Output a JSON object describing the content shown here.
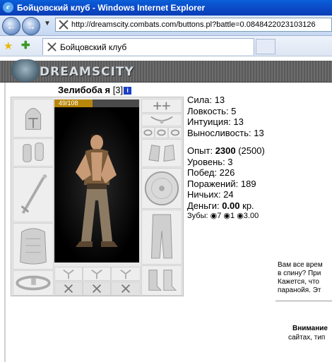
{
  "window": {
    "title": "Бойцовский клуб - Windows Internet Explorer"
  },
  "address_bar": {
    "url": "http://dreamscity.combats.com/buttons.pl?battle=0.0848422023103126"
  },
  "tab": {
    "label": "Бойцовский клуб"
  },
  "banner": {
    "logo_text": "DREAMSCITY"
  },
  "character": {
    "name": "Зелибоба я",
    "level_text": "[3]",
    "hp_text": "49/108",
    "hp_fraction": 0.4537
  },
  "stats": {
    "strength": "Сила: 13",
    "agility": "Ловкость: 5",
    "intuition": "Интуиция: 13",
    "endurance": "Выносливость: 13",
    "exp_label": "Опыт: ",
    "exp_value": "2300",
    "exp_next": " (2500)",
    "level": "Уровень: 3",
    "wins": "Побед: 226",
    "losses": "Поражений: 189",
    "draws": "Ничьих: 24",
    "money_label": "Деньги: ",
    "money_value": "0.00",
    "money_unit": " кр.",
    "teeth_label": "Зубы: ",
    "teeth_a": "7",
    "teeth_b": "1",
    "teeth_c": "3.00"
  },
  "message": {
    "line1": "Вам все врем",
    "line2": "в спину? При",
    "line3": "Кажется, что",
    "line4": "паранойя. Эт"
  },
  "warning": {
    "title": "Внимание",
    "text": "сайтах, тип"
  },
  "icons": [
    "ie-icon",
    "back-icon",
    "forward-icon",
    "favorites-star-icon",
    "add-favorites-icon",
    "tab-close-icon"
  ],
  "colors": {
    "titlebar": "#0b47c4",
    "hp_fill": "#b8860b",
    "link_info": "#1b3fc7"
  }
}
